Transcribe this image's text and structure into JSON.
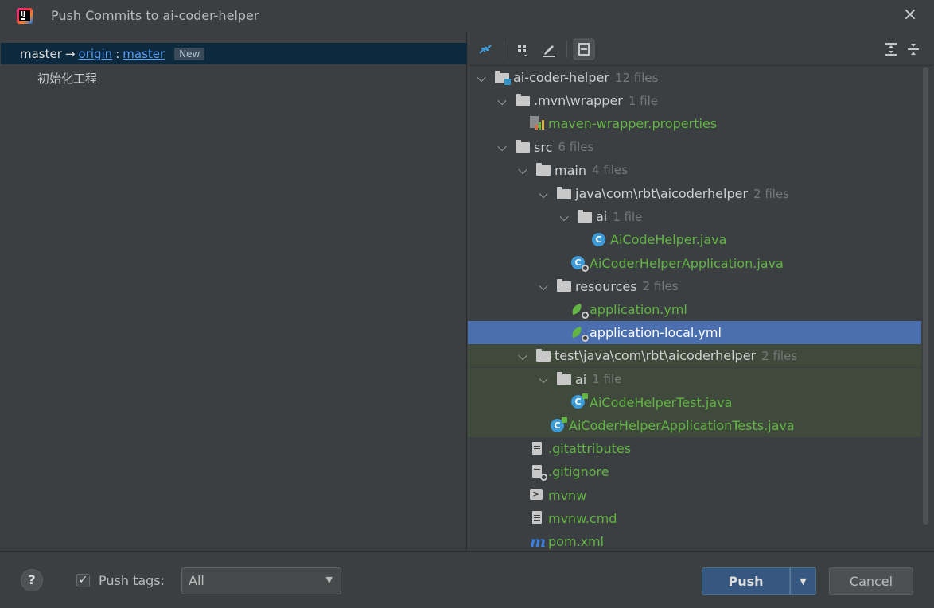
{
  "window": {
    "title": "Push Commits to ai-coder-helper",
    "close_icon": "×"
  },
  "left_pane": {
    "branch": {
      "local": "master",
      "arrow": "→",
      "remote": "origin",
      "sep": ":",
      "remote_branch": "master",
      "badge": "New"
    },
    "commits": [
      "初始化工程"
    ]
  },
  "toolbar": {
    "icons": [
      "show-diff-icon",
      "group-by-icon",
      "edit-icon",
      "preview-icon",
      "expand-all-icon",
      "collapse-all-icon"
    ]
  },
  "tree": [
    {
      "label": "ai-coder-helper",
      "count": "12 files",
      "type": "module",
      "depth": 0,
      "expanded": true,
      "style": "plain"
    },
    {
      "label": ".mvn\\wrapper",
      "count": "1 file",
      "type": "folder",
      "depth": 1,
      "expanded": true,
      "style": "plain"
    },
    {
      "label": "maven-wrapper.properties",
      "count": "",
      "type": "properties",
      "depth": 2,
      "expanded": null,
      "style": "green"
    },
    {
      "label": "src",
      "count": "6 files",
      "type": "folder",
      "depth": 1,
      "expanded": true,
      "style": "plain"
    },
    {
      "label": "main",
      "count": "4 files",
      "type": "folder",
      "depth": 2,
      "expanded": true,
      "style": "plain"
    },
    {
      "label": "java\\com\\rbt\\aicoderhelper",
      "count": "2 files",
      "type": "folder",
      "depth": 3,
      "expanded": true,
      "style": "plain"
    },
    {
      "label": "ai",
      "count": "1 file",
      "type": "folder",
      "depth": 4,
      "expanded": true,
      "style": "plain"
    },
    {
      "label": "AiCodeHelper.java",
      "count": "",
      "type": "class",
      "depth": 5,
      "expanded": null,
      "style": "green"
    },
    {
      "label": "AiCoderHelperApplication.java",
      "count": "",
      "type": "spring-class",
      "depth": 4,
      "expanded": null,
      "style": "green"
    },
    {
      "label": "resources",
      "count": "2 files",
      "type": "folder",
      "depth": 3,
      "expanded": true,
      "style": "plain"
    },
    {
      "label": "application.yml",
      "count": "",
      "type": "spring-yml",
      "depth": 4,
      "expanded": null,
      "style": "green"
    },
    {
      "label": "application-local.yml",
      "count": "",
      "type": "spring-yml",
      "depth": 4,
      "expanded": null,
      "style": "plain",
      "selected": true
    },
    {
      "label": "test\\java\\com\\rbt\\aicoderhelper",
      "count": "2 files",
      "type": "folder",
      "depth": 2,
      "expanded": true,
      "style": "plain",
      "highlighted": true
    },
    {
      "label": "ai",
      "count": "1 file",
      "type": "folder",
      "depth": 3,
      "expanded": true,
      "style": "plain",
      "highlighted": true
    },
    {
      "label": "AiCodeHelperTest.java",
      "count": "",
      "type": "test-class",
      "depth": 4,
      "expanded": null,
      "style": "green",
      "highlighted": true
    },
    {
      "label": "AiCoderHelperApplicationTests.java",
      "count": "",
      "type": "test-class",
      "depth": 3,
      "expanded": null,
      "style": "green",
      "highlighted": true
    },
    {
      "label": ".gitattributes",
      "count": "",
      "type": "text",
      "depth": 2,
      "expanded": null,
      "style": "green"
    },
    {
      "label": ".gitignore",
      "count": "",
      "type": "ignore",
      "depth": 2,
      "expanded": null,
      "style": "green"
    },
    {
      "label": "mvnw",
      "count": "",
      "type": "shell",
      "depth": 2,
      "expanded": null,
      "style": "green"
    },
    {
      "label": "mvnw.cmd",
      "count": "",
      "type": "text",
      "depth": 2,
      "expanded": null,
      "style": "green"
    },
    {
      "label": "pom.xml",
      "count": "",
      "type": "maven",
      "depth": 2,
      "expanded": null,
      "style": "green"
    }
  ],
  "footer": {
    "help": "?",
    "push_tags_checked": "✓",
    "push_tags_label": "Push tags:",
    "push_tags_value": "All",
    "push_btn": "Push",
    "cancel_btn": "Cancel"
  },
  "colors": {
    "background": "#3c3f41",
    "selection": "#4b6eaf",
    "branch_row": "#0d293e",
    "added_file": "#62b543",
    "link": "#589df6",
    "primary_button": "#365880"
  }
}
